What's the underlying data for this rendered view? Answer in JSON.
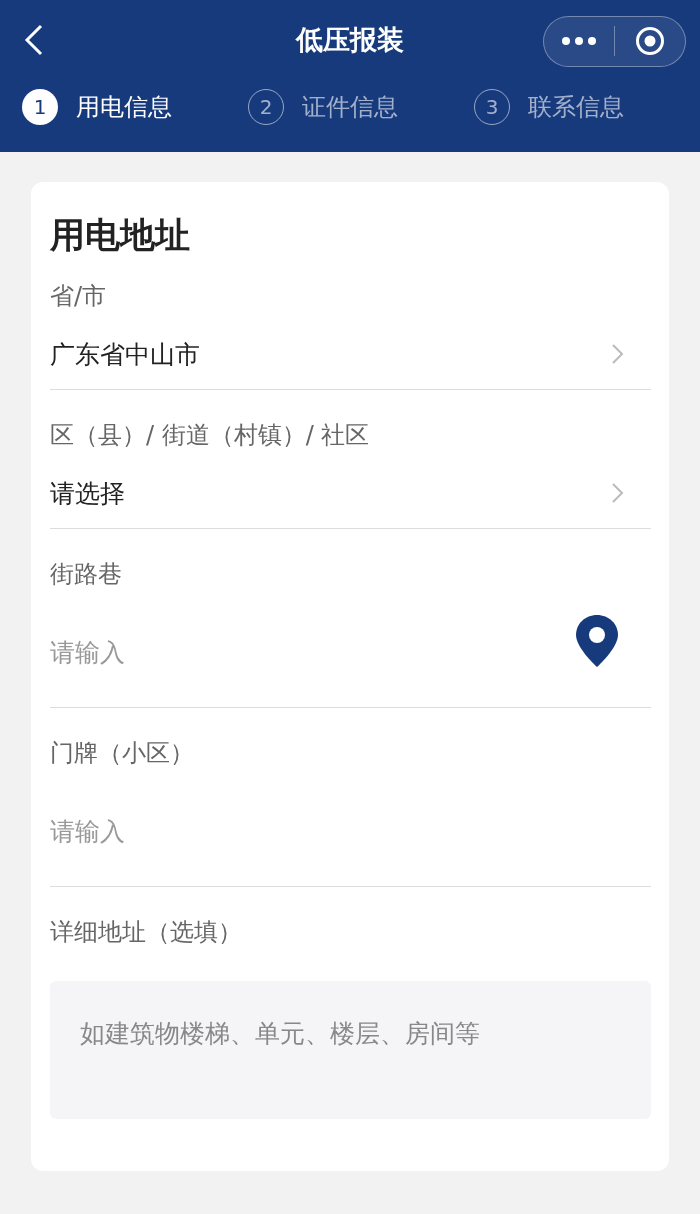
{
  "header": {
    "title": "低压报装"
  },
  "steps": [
    {
      "number": "1",
      "label": "用电信息",
      "selected": true
    },
    {
      "number": "2",
      "label": "证件信息",
      "selected": false
    },
    {
      "number": "3",
      "label": "联系信息",
      "selected": false
    }
  ],
  "section": {
    "title": "用电地址",
    "fields": [
      {
        "kind": "select",
        "label": "省/市",
        "value": "广东省中山市"
      },
      {
        "kind": "select",
        "label": "区（县）/ 街道（村镇）/ 社区",
        "value": "请选择"
      },
      {
        "kind": "location",
        "label": "街路巷",
        "placeholder": "请输入"
      },
      {
        "kind": "input",
        "label": "门牌（小区）",
        "placeholder": "请输入"
      },
      {
        "kind": "textarea",
        "label": "详细地址（选填）",
        "placeholder": "如建筑物楼梯、单元、楼层、房间等"
      }
    ]
  }
}
